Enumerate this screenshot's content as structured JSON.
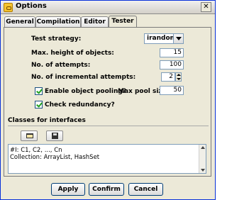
{
  "window": {
    "title": "Options",
    "close_label": "✕"
  },
  "tabs": [
    {
      "label": "General",
      "active": false
    },
    {
      "label": "Compilation",
      "active": false
    },
    {
      "label": "Editor",
      "active": false
    },
    {
      "label": "Tester",
      "active": true
    }
  ],
  "tester": {
    "test_strategy_label": "Test strategy:",
    "test_strategy_value": "irandom",
    "max_height_label": "Max. height of objects:",
    "max_height_value": "15",
    "attempts_label": "No. of attempts:",
    "attempts_value": "100",
    "incremental_label": "No. of incremental attempts:",
    "incremental_value": "2",
    "pooling_label": "Enable object pooling?",
    "pooling_checked": true,
    "max_pool_label": "Max pool size:",
    "max_pool_value": "50",
    "redundancy_label": "Check redundancy?",
    "redundancy_checked": true
  },
  "classes": {
    "group_title": "Classes for interfaces",
    "open_icon": "open-folder-icon",
    "save_icon": "save-disk-icon",
    "text_lines": [
      "#I: C1, C2, ..., Cn",
      "Collection: ArrayList, HashSet"
    ]
  },
  "buttons": {
    "apply": "Apply",
    "confirm": "Confirm",
    "cancel": "Cancel"
  }
}
